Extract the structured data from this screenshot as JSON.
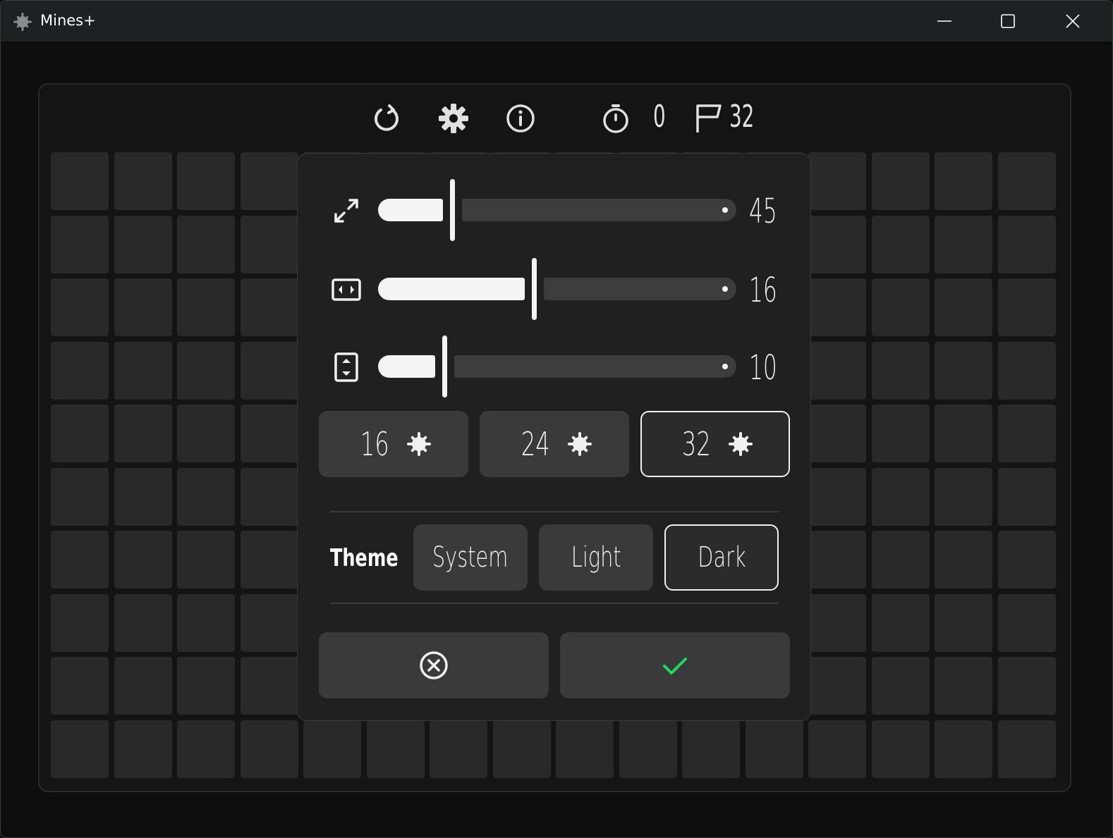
{
  "window": {
    "title": "Mines+",
    "controls": [
      "minimize",
      "maximize",
      "close"
    ]
  },
  "toolbar": {
    "icons": [
      "restart-icon",
      "settings-icon",
      "info-icon",
      "stopwatch-icon",
      "flag-icon"
    ],
    "timer": "0",
    "flags": "32"
  },
  "board": {
    "columns": 16,
    "rows": 10
  },
  "settings": {
    "sliders": [
      {
        "id": "size",
        "icon": "resize-icon",
        "value": "45",
        "fraction": 0.2
      },
      {
        "id": "width",
        "icon": "width-icon",
        "value": "16",
        "fraction": 0.43
      },
      {
        "id": "height",
        "icon": "height-icon",
        "value": "10",
        "fraction": 0.18
      }
    ],
    "mine_presets": [
      {
        "label": "16",
        "icon": "mine-icon",
        "selected": false
      },
      {
        "label": "24",
        "icon": "mine-icon",
        "selected": false
      },
      {
        "label": "32",
        "icon": "mine-icon",
        "selected": true
      }
    ],
    "theme": {
      "title": "Theme",
      "options": [
        {
          "label": "System",
          "selected": false
        },
        {
          "label": "Light",
          "selected": false
        },
        {
          "label": "Dark",
          "selected": true
        }
      ]
    },
    "actions": {
      "cancel_icon": "cancel-icon",
      "confirm_icon": "checkmark-icon",
      "confirm_color": "#1ed760"
    }
  },
  "colors": {
    "titlebar": "#1e2022",
    "cell": "#292929",
    "dialog": "#202020",
    "accent": "#f4f4f4"
  }
}
